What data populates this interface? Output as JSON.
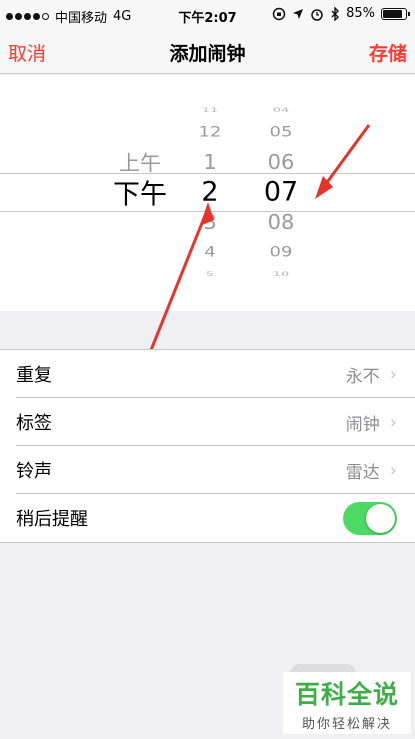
{
  "status_bar": {
    "carrier": "中国移动",
    "network": "4G",
    "time": "下午2:07",
    "battery_percent": "85%",
    "battery_level": 0.85
  },
  "nav": {
    "cancel": "取消",
    "title": "添加闹钟",
    "save": "存储"
  },
  "picker": {
    "ampm": {
      "items": [
        "上午",
        "下午"
      ],
      "selected": "下午"
    },
    "hours": {
      "items": [
        "11",
        "12",
        "1",
        "2",
        "3",
        "4",
        "5"
      ],
      "selected": "2"
    },
    "minutes": {
      "items": [
        "04",
        "05",
        "06",
        "07",
        "08",
        "09",
        "10"
      ],
      "selected": "07"
    }
  },
  "settings": {
    "repeat": {
      "label": "重复",
      "value": "永不"
    },
    "label": {
      "label": "标签",
      "value": "闹钟"
    },
    "sound": {
      "label": "铃声",
      "value": "雷达"
    },
    "snooze": {
      "label": "稍后提醒",
      "enabled": true
    }
  },
  "watermark": {
    "title": "百科全说",
    "subtitle": "助你轻松解决"
  },
  "colors": {
    "accent": "#ff3b30",
    "toggle_on": "#4cd964",
    "annotation": "#e8322a"
  }
}
